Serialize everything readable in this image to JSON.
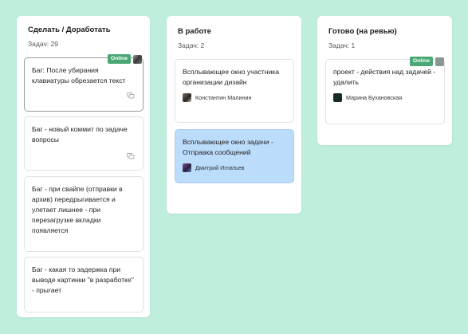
{
  "columns": [
    {
      "title": "Сделать / Доработать",
      "count_label": "Задач: 29",
      "cards": [
        {
          "text": "Баг: После убирания клавиатуры обрезается текст",
          "online": "Online"
        },
        {
          "text": "Баг - новый коммит по задаче вопросы"
        },
        {
          "text": "Баг - при свайпе (отправки в архив) передрыгивается и улетает лишнее - при перезагрузке вкладки появляется"
        },
        {
          "text": "Баг - какая то задержка при выводе картинки \"в разработке\" - прыгает"
        }
      ]
    },
    {
      "title": "В работе",
      "count_label": "Задач: 2",
      "cards": [
        {
          "text": "Всплывающее окно участника организации дизайн",
          "assignee": "Константин Малинин"
        },
        {
          "text": "Всплывающее окно задачи - Отправка сообщений",
          "assignee": "Дмитрий Игнатьев"
        }
      ]
    },
    {
      "title": "Готово (на ревью)",
      "count_label": "Задач: 1",
      "cards": [
        {
          "text": "проект - действия над задачей - удалить",
          "assignee": "Марина Бухановская",
          "online": "Online"
        }
      ]
    }
  ],
  "colors": {
    "background": "#bfeedd",
    "selected_card": "#bcdcfb",
    "online_badge": "#4aa874"
  },
  "icons": [
    "comment-icon",
    "avatar"
  ]
}
